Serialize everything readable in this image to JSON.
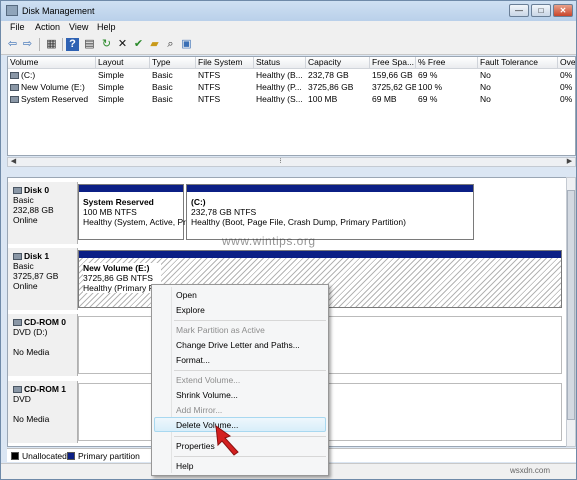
{
  "window": {
    "title": "Disk Management"
  },
  "window_buttons": {
    "minimize": "—",
    "maximize": "□",
    "close": "✕"
  },
  "menubar": [
    "File",
    "Action",
    "View",
    "Help"
  ],
  "toolbar": {
    "icons": [
      "back-icon",
      "forward-icon",
      "console-tree-icon",
      "help-icon",
      "properties-icon",
      "refresh-icon",
      "delete-icon",
      "check-icon",
      "folder-open-icon",
      "search-icon",
      "disk-view-icon"
    ],
    "glyphs": [
      "⇦",
      "⇨",
      "▦",
      "?",
      "▤",
      "↻",
      "✕",
      "✔",
      "▰",
      "⌕",
      "▣"
    ]
  },
  "volumes": {
    "columns": [
      "Volume",
      "Layout",
      "Type",
      "File System",
      "Status",
      "Capacity",
      "Free Spa...",
      "% Free",
      "Fault Tolerance",
      "Ove"
    ],
    "rows": [
      [
        "(C:)",
        "Simple",
        "Basic",
        "NTFS",
        "Healthy (B...",
        "232,78 GB",
        "159,66 GB",
        "69 %",
        "No",
        "0%"
      ],
      [
        "New Volume (E:)",
        "Simple",
        "Basic",
        "NTFS",
        "Healthy (P...",
        "3725,86 GB",
        "3725,62 GB",
        "100 %",
        "No",
        "0%"
      ],
      [
        "System Reserved",
        "Simple",
        "Basic",
        "NTFS",
        "Healthy (S...",
        "100 MB",
        "69 MB",
        "69 %",
        "No",
        "0%"
      ]
    ]
  },
  "disks": [
    {
      "name": "Disk 0",
      "kind": "Basic",
      "size": "232,88 GB",
      "state": "Online",
      "partitions": [
        {
          "name": "System Reserved",
          "size": "100 MB NTFS",
          "status": "Healthy (System, Active, Pr"
        },
        {
          "name": "(C:)",
          "size": "232,78 GB NTFS",
          "status": "Healthy (Boot, Page File, Crash Dump, Primary Partition)"
        }
      ]
    },
    {
      "name": "Disk 1",
      "kind": "Basic",
      "size": "3725,87 GB",
      "state": "Online",
      "partitions": [
        {
          "name": "New Volume  (E:)",
          "size": "3725,86 GB NTFS",
          "status": "Healthy (Primary Pa"
        }
      ]
    },
    {
      "name": "CD-ROM 0",
      "kind": "DVD (D:)",
      "state": "No Media"
    },
    {
      "name": "CD-ROM 1",
      "kind": "DVD",
      "state": "No Media"
    }
  ],
  "legend": [
    {
      "label": "Unallocated",
      "color": "#000000"
    },
    {
      "label": "Primary partition",
      "color": "#0b1f85"
    }
  ],
  "context_menu": {
    "items": [
      {
        "label": "Open",
        "enabled": true
      },
      {
        "label": "Explore",
        "enabled": true
      },
      {
        "label": "Mark Partition as Active",
        "enabled": false
      },
      {
        "label": "Change Drive Letter and Paths...",
        "enabled": true
      },
      {
        "label": "Format...",
        "enabled": true
      },
      {
        "label": "Extend Volume...",
        "enabled": false
      },
      {
        "label": "Shrink Volume...",
        "enabled": true
      },
      {
        "label": "Add Mirror...",
        "enabled": false
      },
      {
        "label": "Delete Volume...",
        "enabled": true,
        "highlighted": true
      },
      {
        "label": "Properties",
        "enabled": true
      },
      {
        "label": "Help",
        "enabled": true
      }
    ]
  },
  "watermarks": {
    "center": "www.wintips.org",
    "corner": "wsxdn.com"
  },
  "colors": {
    "accent_arrow": "#d42020",
    "primary_partition": "#0b1f85"
  }
}
